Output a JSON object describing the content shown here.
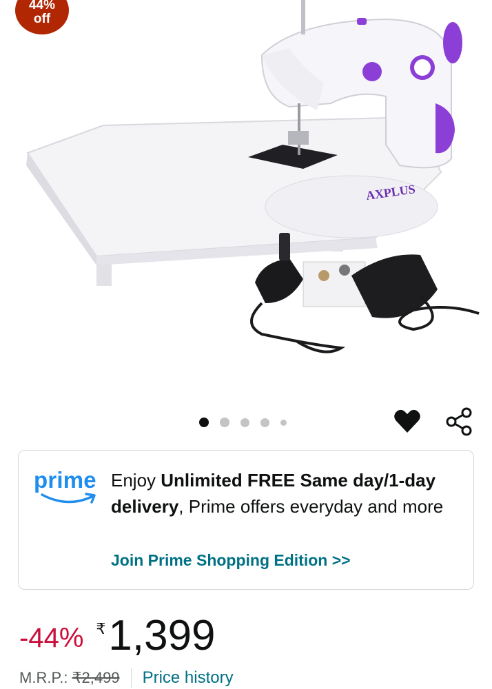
{
  "badge": {
    "line1": "44%",
    "line2": "off"
  },
  "product_image": {
    "brand_text": "AXPLUS",
    "alt": "sewing-machine-with-extension-table"
  },
  "carousel": {
    "count": 5,
    "active_index": 0
  },
  "icons": {
    "wishlist": "heart-icon",
    "share": "share-icon"
  },
  "prime": {
    "logo_text": "prime",
    "text_prefix": "Enjoy ",
    "text_bold1": "Unlimited FREE Same day/1-day delivery",
    "text_suffix": ", Prime offers everyday and more",
    "link": "Join Prime Shopping Edition >>"
  },
  "price": {
    "discount": "-44%",
    "currency": "₹",
    "value": "1,399",
    "mrp_label": "M.R.P.:",
    "mrp_value": "₹2,499",
    "history_link": "Price history"
  },
  "colors": {
    "prime_blue": "#1f8ded",
    "link_teal": "#007185",
    "discount_red": "#cc0c39",
    "badge_red": "#b12704",
    "accent_purple": "#8b3fd6"
  }
}
